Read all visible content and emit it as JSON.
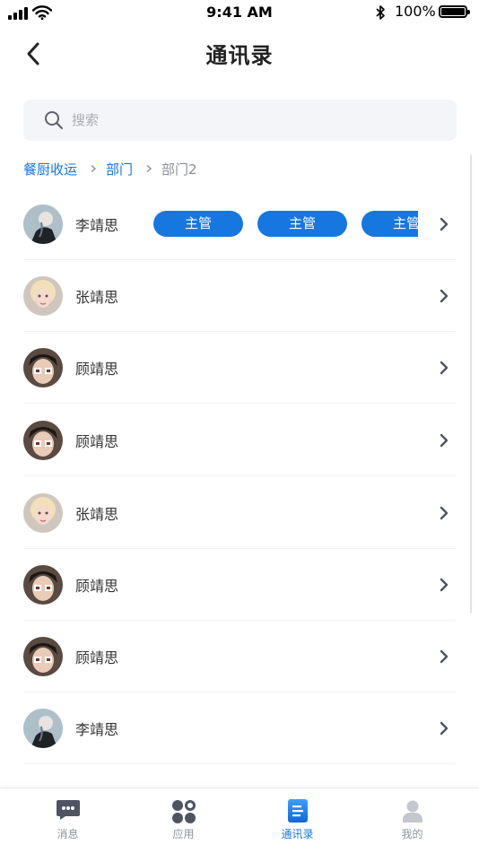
{
  "status_bar": {
    "time": "9:41 AM",
    "battery": "100%"
  },
  "header": {
    "title": "通讯录"
  },
  "search": {
    "placeholder": "搜索",
    "value": ""
  },
  "breadcrumb": [
    "餐厨收运",
    "部门",
    "部门2"
  ],
  "contacts": [
    {
      "name": "李靖思",
      "avatar": "avatar-blue-tone",
      "tags": [
        "主管",
        "主管",
        "主管"
      ]
    },
    {
      "name": "张靖思",
      "avatar": "avatar-blonde-tone",
      "tags": []
    },
    {
      "name": "顾靖思",
      "avatar": "avatar-dark-tone",
      "tags": []
    },
    {
      "name": "顾靖思",
      "avatar": "avatar-dark-tone",
      "tags": []
    },
    {
      "name": "张靖思",
      "avatar": "avatar-blonde-tone",
      "tags": []
    },
    {
      "name": "顾靖思",
      "avatar": "avatar-dark-tone",
      "tags": []
    },
    {
      "name": "顾靖思",
      "avatar": "avatar-dark-tone",
      "tags": []
    },
    {
      "name": "李靖思",
      "avatar": "avatar-blue-tone",
      "tags": []
    }
  ],
  "tabs": [
    {
      "label": "消息",
      "icon": "message-icon",
      "active": false
    },
    {
      "label": "应用",
      "icon": "apps-icon",
      "active": false
    },
    {
      "label": "通讯录",
      "icon": "contacts-icon",
      "active": true
    },
    {
      "label": "我的",
      "icon": "profile-icon",
      "active": false
    }
  ],
  "colors": {
    "accent": "#1677e0",
    "text": "#333333",
    "muted": "#8a8f97",
    "divider": "#eef0f3"
  }
}
